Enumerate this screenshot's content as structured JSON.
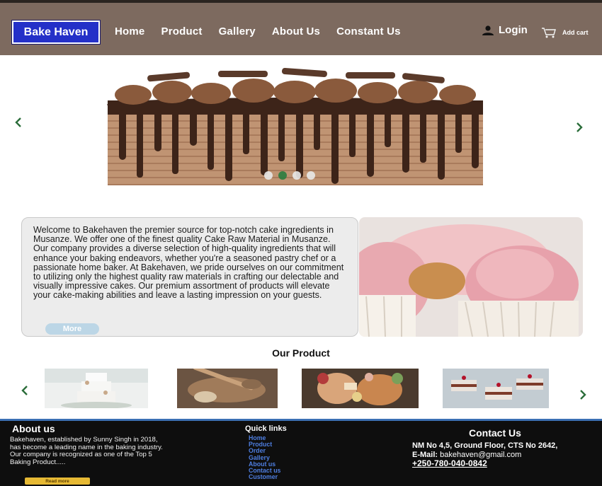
{
  "header": {
    "brand": "Bake Haven",
    "nav": [
      "Home",
      "Product",
      "Gallery",
      "About Us",
      "Constant Us"
    ],
    "login": "Login",
    "cart": "Add cart"
  },
  "hero": {
    "prev_icon": "chevron-left-icon",
    "next_icon": "chevron-right-icon",
    "slide_count": 4,
    "active_slide": 2
  },
  "welcome": {
    "text": "Welcome to Bakehaven the premier source for top-notch cake ingredients in Musanze. We offer one of the finest quality Cake Raw Material in Musanze. Our company provides a diverse selection of high-quality ingredients that will enhance your baking endeavors, whether you're a seasoned pastry chef or a passionate home baker. At Bakehaven, we pride ourselves on our commitment to utilizing only the highest quality raw materials in crafting our delectable and visually impressive cakes. Our premium assortment of products will elevate your cake-making abilities and leave a lasting impression on your guests.",
    "more": "More"
  },
  "products": {
    "title": "Our Product"
  },
  "footer": {
    "about_title": "About us",
    "about_text": "Bakehaven, established by Sunny Singh in 2018, has become a leading name in the baking industry. Our company is recognized as one of the Top 5 Baking Product.....",
    "read_more": "Read more",
    "quick_title": "Quick links",
    "links": [
      "Home",
      "Product",
      "Order",
      "Gallery",
      "About us",
      "Contact us",
      "Customer"
    ],
    "contact_title": "Contact Us",
    "address": "NM No 4,5, Ground Floor, CTS No 2642,",
    "email_label": "E-Mail:",
    "email_value": "bakehaven@gmail.com",
    "phone": "+250-780-040-0842"
  },
  "colors": {
    "header_bg": "#7d6a5f",
    "brand_bg": "#2430c8",
    "arrow": "#2b6d3a",
    "footer_bg": "#0e0e0e",
    "link": "#4e7ee0",
    "read_more_bg": "#e6b934"
  }
}
